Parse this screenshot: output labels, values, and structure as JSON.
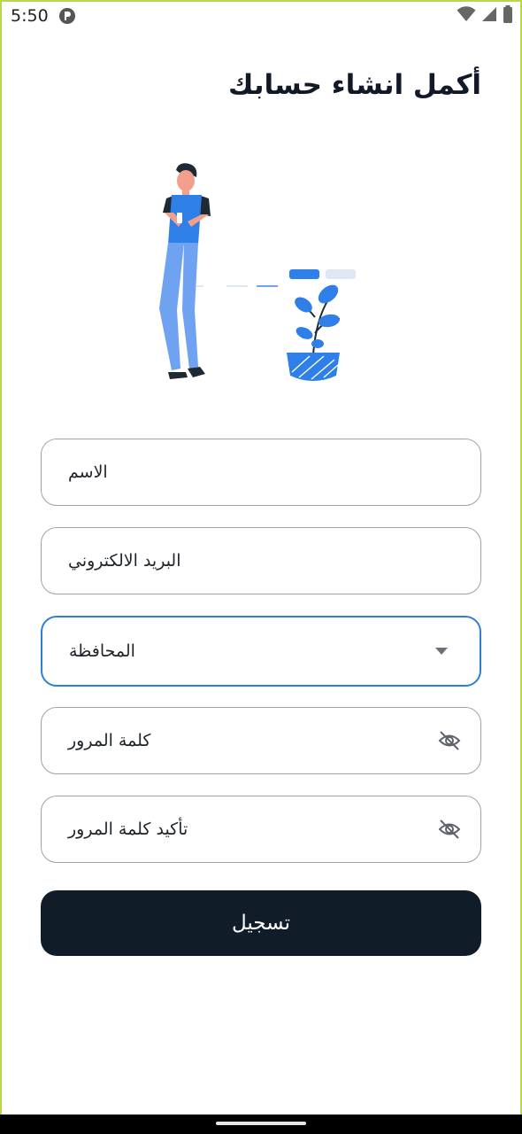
{
  "status_bar": {
    "time": "5:50",
    "icons": [
      "app-notification-icon",
      "wifi-icon",
      "signal-icon",
      "battery-icon"
    ]
  },
  "page": {
    "title": "أكمل انشاء حسابك"
  },
  "illustration": {
    "name": "person-with-plant-illustration",
    "colors": {
      "primary": "#2f7fe8",
      "light": "#6fa2f0",
      "dark": "#1f2933"
    }
  },
  "form": {
    "name_field": {
      "label": "الاسم"
    },
    "email_field": {
      "label": "البريد الالكتروني"
    },
    "governorate_field": {
      "label": "المحافظة",
      "icon": "dropdown-arrow-icon"
    },
    "password_field": {
      "label": "كلمة المرور",
      "icon": "eye-off-icon"
    },
    "confirm_password_field": {
      "label": "تأكيد كلمة المرور",
      "icon": "eye-off-icon"
    },
    "submit_label": "تسجيل"
  },
  "colors": {
    "button_bg": "#111c29",
    "focus_border": "#2f7fd6",
    "border": "#9ea3aa",
    "frame_border": "#b6d84a"
  }
}
